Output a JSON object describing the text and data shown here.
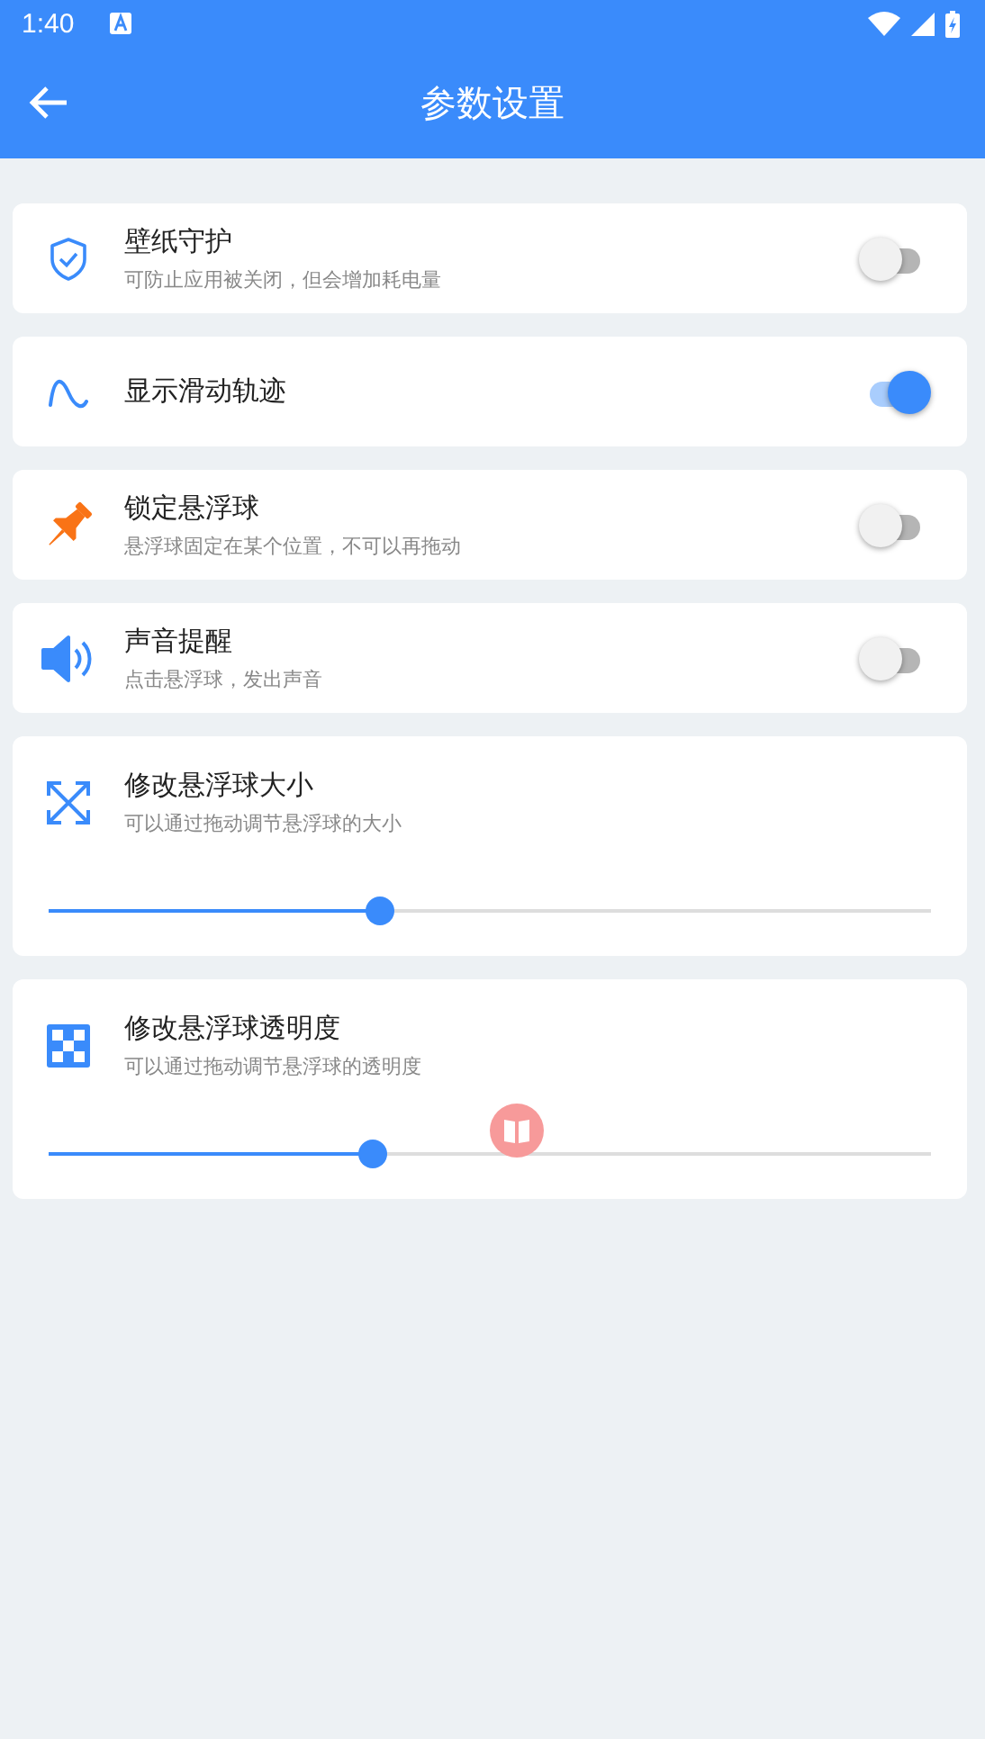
{
  "status_bar": {
    "time": "1:40"
  },
  "app_bar": {
    "title": "参数设置"
  },
  "settings": [
    {
      "kind": "toggle",
      "title": "壁纸守护",
      "subtitle": "可防止应用被关闭，但会增加耗电量",
      "on": false
    },
    {
      "kind": "toggle",
      "title": "显示滑动轨迹",
      "on": true
    },
    {
      "kind": "toggle",
      "title": "锁定悬浮球",
      "subtitle": "悬浮球固定在某个位置，不可以再拖动",
      "on": false
    },
    {
      "kind": "toggle",
      "title": "声音提醒",
      "subtitle": "点击悬浮球，发出声音",
      "on": false
    },
    {
      "kind": "slider",
      "title": "修改悬浮球大小",
      "subtitle": "可以通过拖动调节悬浮球的大小",
      "level": 0.375
    },
    {
      "kind": "slider",
      "title": "修改悬浮球透明度",
      "subtitle": "可以通过拖动调节悬浮球的透明度",
      "level": 0.367
    }
  ]
}
